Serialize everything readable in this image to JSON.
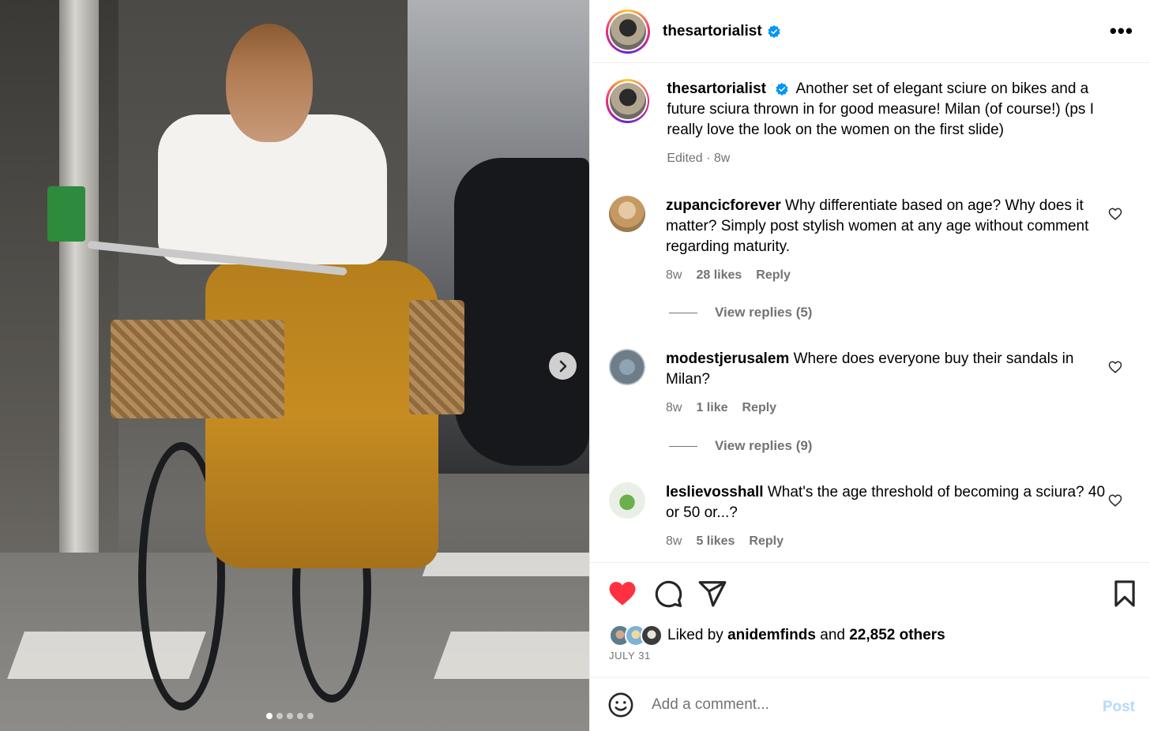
{
  "post": {
    "username": "thesartorialist",
    "caption": "Another set of elegant sciure on bikes and a future sciura thrown in for good measure! Milan (of course!) (ps I really love the look on the women on the first slide)",
    "caption_meta": "Edited · 8w"
  },
  "carousel": {
    "active_index": 1,
    "total": 5
  },
  "comments": [
    {
      "username": "zupancicforever",
      "text": "Why differentiate based on age? Why does it matter? Simply post stylish women at any age without comment regarding maturity.",
      "time": "8w",
      "likes": "28 likes",
      "reply": "Reply",
      "view_replies": "View replies (5)"
    },
    {
      "username": "modestjerusalem",
      "text": "Where does everyone buy their sandals in Milan?",
      "time": "8w",
      "likes": "1 like",
      "reply": "Reply",
      "view_replies": "View replies (9)"
    },
    {
      "username": "leslievosshall",
      "text": "What's the age threshold of becoming a sciura? 40 or 50 or...?",
      "time": "8w",
      "likes": "5 likes",
      "reply": "Reply"
    }
  ],
  "likes": {
    "prefix": "Liked by",
    "user": "anidemfinds",
    "joiner": "and",
    "others": "22,852 others"
  },
  "date": "JULY 31",
  "comment_box": {
    "placeholder": "Add a comment...",
    "post_label": "Post"
  },
  "icons": {
    "more": "more-options-icon",
    "next": "chevron-right-icon",
    "like": "heart-filled-icon",
    "comment": "comment-icon",
    "share": "paper-plane-icon",
    "save": "bookmark-icon",
    "emoji": "emoji-icon",
    "verified": "verified-badge-icon"
  },
  "colors": {
    "like_red": "#ff3040",
    "verified_blue": "#0095f6",
    "muted": "#737373",
    "post_disabled": "#b3dbff"
  }
}
